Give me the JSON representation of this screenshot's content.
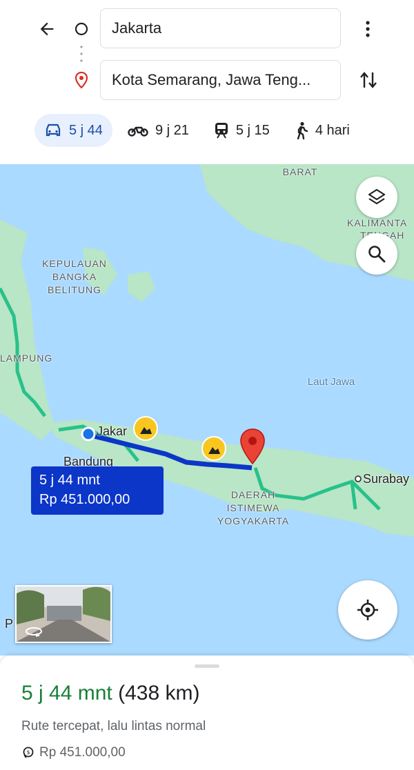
{
  "search": {
    "origin": "Jakarta",
    "destination": "Kota Semarang, Jawa Teng..."
  },
  "modes": [
    {
      "icon": "car-icon",
      "label": "5 j 44",
      "active": true
    },
    {
      "icon": "motorcycle-icon",
      "label": "9 j 21",
      "active": false
    },
    {
      "icon": "train-icon",
      "label": "5 j 15",
      "active": false
    },
    {
      "icon": "walk-icon",
      "label": "4 hari",
      "active": false
    }
  ],
  "map": {
    "labels": {
      "barat": "BARAT",
      "kalimantan": "KALIMANTA",
      "tengah": "TENGAH",
      "bangka": "KEPULAUAN\nBANGKA\nBELITUNG",
      "lampung": "LAMPUNG",
      "laut_jawa": "Laut Jawa",
      "jakarta": "Jakar",
      "bandung": "Bandung",
      "diy": "DAERAH\nISTIMEWA\nYOGYAKARTA",
      "surabaya": "Surabay",
      "p": "P"
    },
    "route_box": {
      "duration": "5 j 44 mnt",
      "cost": "Rp 451.000,00"
    },
    "colors": {
      "water": "#aadaff",
      "land": "#b8e6c6",
      "route": "#0b36c8",
      "highway": "#28c18a"
    }
  },
  "sheet": {
    "eta_time": "5 j 44 mnt",
    "eta_distance": "(438 km)",
    "description": "Rute tercepat, lalu lintas normal",
    "toll": "Rp 451.000,00"
  }
}
